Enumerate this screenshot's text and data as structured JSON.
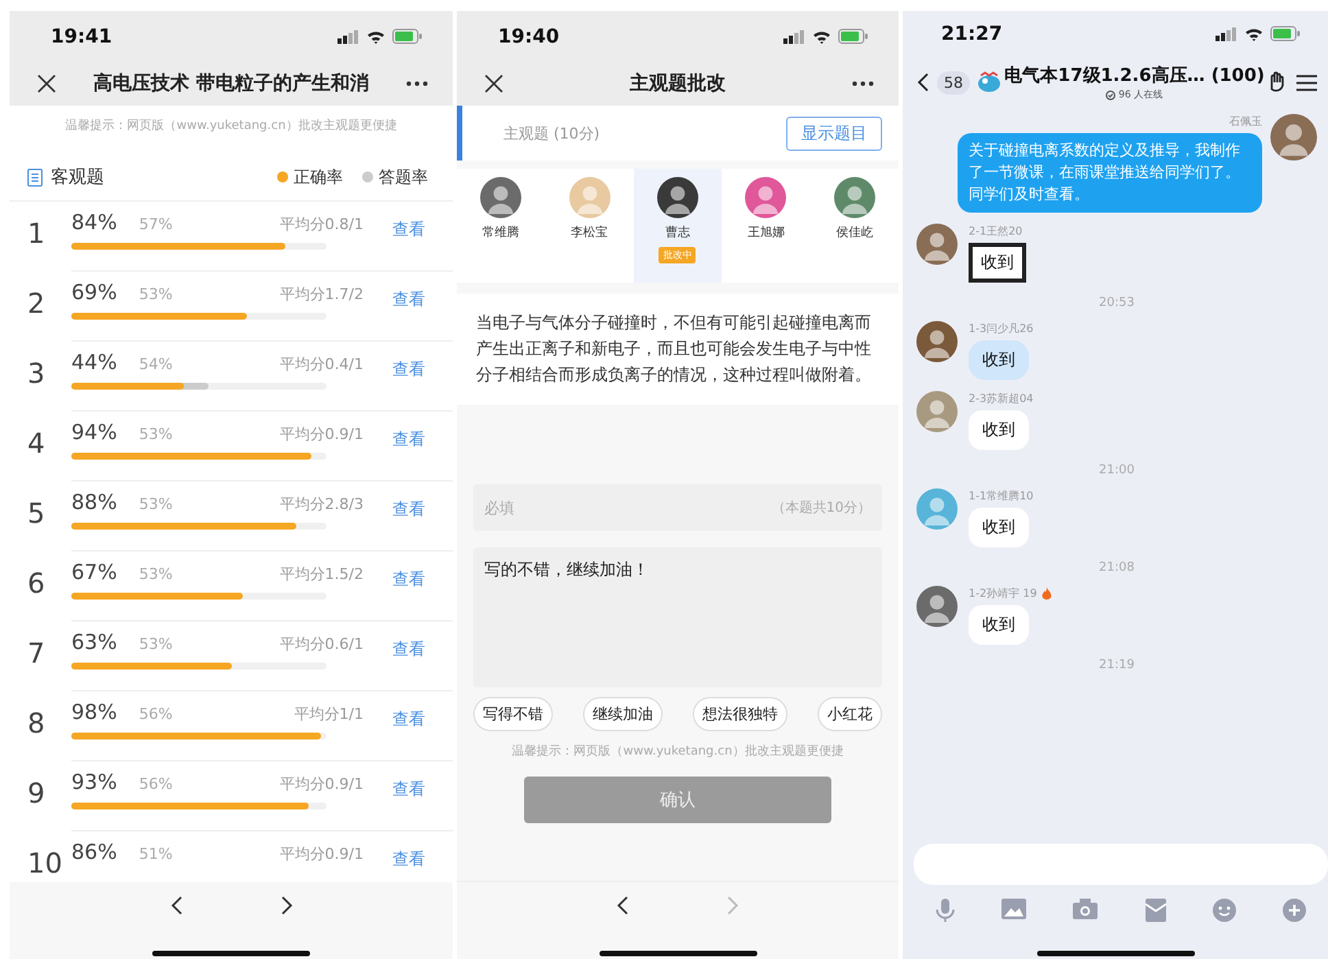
{
  "stats_screen": {
    "status_time": "19:41",
    "title": "高电压技术 带电粒子的产生和消",
    "hint": "温馨提示：网页版（www.yuketang.cn）批改主观题更便捷",
    "section": "客观题",
    "legend": [
      {
        "label": "正确率",
        "color": "#f5a623"
      },
      {
        "label": "答题率",
        "color": "#cccccc"
      }
    ],
    "rows": [
      {
        "number": "1",
        "correct": "84%",
        "answered": "57%",
        "average": "平均分0.8/1",
        "link": "查看",
        "correct_bar": {
          "level": 0.84
        },
        "answered_bar": {
          "level": 0.57
        }
      },
      {
        "number": "2",
        "correct": "69%",
        "answered": "53%",
        "average": "平均分1.7/2",
        "link": "查看",
        "correct_bar": {
          "level": 0.69
        },
        "answered_bar": {
          "level": 0.53
        }
      },
      {
        "number": "3",
        "correct": "44%",
        "answered": "54%",
        "average": "平均分0.4/1",
        "link": "查看",
        "correct_bar": {
          "level": 0.44
        },
        "answered_bar": {
          "level": 0.54
        }
      },
      {
        "number": "4",
        "correct": "94%",
        "answered": "53%",
        "average": "平均分0.9/1",
        "link": "查看",
        "correct_bar": {
          "level": 0.94
        },
        "answered_bar": {
          "level": 0.53
        }
      },
      {
        "number": "5",
        "correct": "88%",
        "answered": "53%",
        "average": "平均分2.8/3",
        "link": "查看",
        "correct_bar": {
          "level": 0.88
        },
        "answered_bar": {
          "level": 0.53
        }
      },
      {
        "number": "6",
        "correct": "67%",
        "answered": "53%",
        "average": "平均分1.5/2",
        "link": "查看",
        "correct_bar": {
          "level": 0.67
        },
        "answered_bar": {
          "level": 0.53
        }
      },
      {
        "number": "7",
        "correct": "63%",
        "answered": "53%",
        "average": "平均分0.6/1",
        "link": "查看",
        "correct_bar": {
          "level": 0.63
        },
        "answered_bar": {
          "level": 0.53
        }
      },
      {
        "number": "8",
        "correct": "98%",
        "answered": "56%",
        "average": "平均分1/1",
        "link": "查看",
        "correct_bar": {
          "level": 0.98
        },
        "answered_bar": {
          "level": 0.56
        }
      },
      {
        "number": "9",
        "correct": "93%",
        "answered": "56%",
        "average": "平均分0.9/1",
        "link": "查看",
        "correct_bar": {
          "level": 0.93
        },
        "answered_bar": {
          "level": 0.56
        }
      },
      {
        "number": "10",
        "correct": "86%",
        "answered": "51%",
        "average": "平均分0.9/1",
        "link": "查看"
      }
    ]
  },
  "grading_screen": {
    "status_time": "19:40",
    "title": "主观题批改",
    "question_label": "主观题 (10分)",
    "show_button": "显示题目",
    "students": [
      {
        "name": "常维腾",
        "selected": false
      },
      {
        "name": "李松宝",
        "selected": false
      },
      {
        "name": "曹志",
        "selected": true,
        "badge": "批改中"
      },
      {
        "name": "王旭娜",
        "selected": false
      },
      {
        "name": "侯佳屹",
        "selected": false
      }
    ],
    "answer": "当电子与气体分子碰撞时，不但有可能引起碰撞电离而产生出正离子和新电子，而且也可能会发生电子与中性分子相结合而形成负离子的情况，这种过程叫做附着。",
    "score_field": {
      "placeholder": "必填",
      "note": "（本题共10分）"
    },
    "comment": "写的不错，继续加油！",
    "chips": [
      "写得不错",
      "继续加油",
      "想法很独特",
      "小红花"
    ],
    "hint": "温馨提示：网页版（www.yuketang.cn）批改主观题更便捷",
    "confirm": "确认",
    "next_disabled": true
  },
  "chat_screen": {
    "status_time": "21:27",
    "back_count": "58",
    "title": "电气本17级1.2.6高压…",
    "member_count": "(100)",
    "online": "96 人在线",
    "messages": [
      {
        "kind": "outgoing",
        "sender": "石佩玉",
        "text": "关于碰撞电离系数的定义及推导，我制作了一节微课，在雨课堂推送给同学们了。同学们及时查看。"
      },
      {
        "kind": "sticker",
        "sender": "2-1王然20",
        "text": "收到"
      },
      {
        "kind": "time",
        "text": "20:53"
      },
      {
        "kind": "cloud",
        "sender": "1-3闫少凡26",
        "text": "收到"
      },
      {
        "kind": "incoming",
        "sender": "2-3苏新超04",
        "flame": false,
        "text": "收到"
      },
      {
        "kind": "time",
        "text": "21:00"
      },
      {
        "kind": "incoming",
        "sender": "1-1常维腾10",
        "flame": false,
        "text": "收到"
      },
      {
        "kind": "time",
        "text": "21:08"
      },
      {
        "kind": "incoming",
        "sender": "1-2孙靖宇 19",
        "flame": true,
        "text": "收到"
      },
      {
        "kind": "time",
        "text": "21:19"
      }
    ]
  }
}
